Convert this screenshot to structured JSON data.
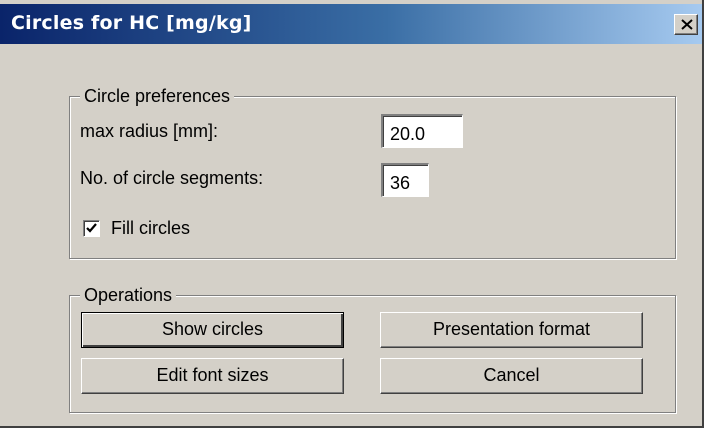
{
  "window": {
    "title": "Circles for HC [mg/kg]"
  },
  "circle_preferences": {
    "legend": "Circle preferences",
    "max_radius_label": "max radius [mm]:",
    "max_radius_value": "20.0",
    "segments_label": "No. of circle segments:",
    "segments_value": "36",
    "fill_circles_label": "Fill circles",
    "fill_circles_checked": true
  },
  "operations": {
    "legend": "Operations",
    "show_circles_label": "Show circles",
    "presentation_format_label": "Presentation format",
    "edit_font_sizes_label": "Edit font sizes",
    "cancel_label": "Cancel"
  },
  "icons": {
    "close": "close-icon",
    "check": "checkmark-icon"
  }
}
